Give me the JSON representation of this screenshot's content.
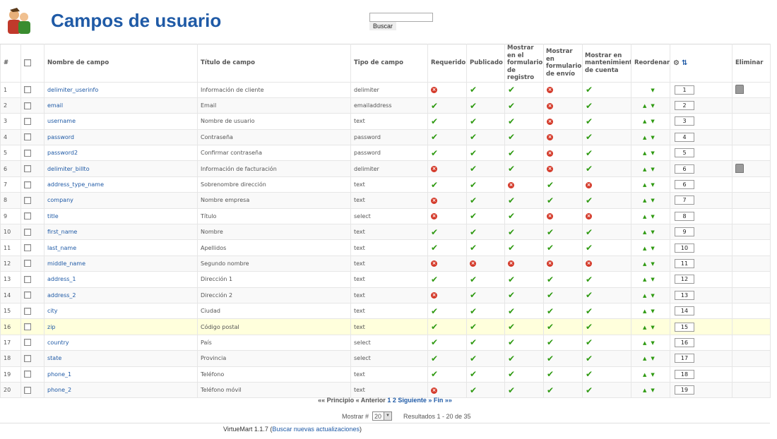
{
  "header": {
    "title": "Campos de usuario",
    "search_value": "",
    "search_button": "Buscar"
  },
  "columns": {
    "num": "#",
    "field_name": "Nombre de campo",
    "field_title": "Título de campo",
    "field_type": "Tipo de campo",
    "required": "Requerido",
    "published": "Publicado",
    "show_registration": "Mostrar en el formulario de registro",
    "show_shipping": "Mostrar en formulario de envío",
    "show_account": "Mostrar en mantenimiento de cuenta",
    "reorder": "Reordenar",
    "delete": "Eliminar"
  },
  "rows": [
    {
      "num": "1",
      "name": "delimiter_userinfo",
      "title": "Información de cliente",
      "type": "delimiter",
      "req": false,
      "pub": true,
      "reg": true,
      "ship": false,
      "acc": true,
      "order": "1",
      "up": false,
      "down": true,
      "del": true
    },
    {
      "num": "2",
      "name": "email",
      "title": "Email",
      "type": "emailaddress",
      "req": true,
      "pub": true,
      "reg": true,
      "ship": false,
      "acc": true,
      "order": "2",
      "up": true,
      "down": true,
      "del": false
    },
    {
      "num": "3",
      "name": "username",
      "title": "Nombre de usuario",
      "type": "text",
      "req": true,
      "pub": true,
      "reg": true,
      "ship": false,
      "acc": true,
      "order": "3",
      "up": true,
      "down": true,
      "del": false
    },
    {
      "num": "4",
      "name": "password",
      "title": "Contraseña",
      "type": "password",
      "req": true,
      "pub": true,
      "reg": true,
      "ship": false,
      "acc": true,
      "order": "4",
      "up": true,
      "down": true,
      "del": false
    },
    {
      "num": "5",
      "name": "password2",
      "title": "Confirmar contraseña",
      "type": "password",
      "req": true,
      "pub": true,
      "reg": true,
      "ship": false,
      "acc": true,
      "order": "5",
      "up": true,
      "down": true,
      "del": false
    },
    {
      "num": "6",
      "name": "delimiter_billto",
      "title": "Información de facturación",
      "type": "delimiter",
      "req": false,
      "pub": true,
      "reg": true,
      "ship": false,
      "acc": true,
      "order": "6",
      "up": true,
      "down": true,
      "del": true
    },
    {
      "num": "7",
      "name": "address_type_name",
      "title": "Sobrenombre dirección",
      "type": "text",
      "req": true,
      "pub": true,
      "reg": false,
      "ship": true,
      "acc": false,
      "order": "6",
      "up": true,
      "down": true,
      "del": false
    },
    {
      "num": "8",
      "name": "company",
      "title": "Nombre empresa",
      "type": "text",
      "req": false,
      "pub": true,
      "reg": true,
      "ship": true,
      "acc": true,
      "order": "7",
      "up": true,
      "down": true,
      "del": false
    },
    {
      "num": "9",
      "name": "title",
      "title": "Título",
      "type": "select",
      "req": false,
      "pub": true,
      "reg": true,
      "ship": false,
      "acc": false,
      "order": "8",
      "up": true,
      "down": true,
      "del": false
    },
    {
      "num": "10",
      "name": "first_name",
      "title": "Nombre",
      "type": "text",
      "req": true,
      "pub": true,
      "reg": true,
      "ship": true,
      "acc": true,
      "order": "9",
      "up": true,
      "down": true,
      "del": false
    },
    {
      "num": "11",
      "name": "last_name",
      "title": "Apellidos",
      "type": "text",
      "req": true,
      "pub": true,
      "reg": true,
      "ship": true,
      "acc": true,
      "order": "10",
      "up": true,
      "down": true,
      "del": false
    },
    {
      "num": "12",
      "name": "middle_name",
      "title": "Segundo nombre",
      "type": "text",
      "req": false,
      "pub": false,
      "reg": false,
      "ship": false,
      "acc": false,
      "order": "11",
      "up": true,
      "down": true,
      "del": false
    },
    {
      "num": "13",
      "name": "address_1",
      "title": "Dirección 1",
      "type": "text",
      "req": true,
      "pub": true,
      "reg": true,
      "ship": true,
      "acc": true,
      "order": "12",
      "up": true,
      "down": true,
      "del": false
    },
    {
      "num": "14",
      "name": "address_2",
      "title": "Dirección 2",
      "type": "text",
      "req": false,
      "pub": true,
      "reg": true,
      "ship": true,
      "acc": true,
      "order": "13",
      "up": true,
      "down": true,
      "del": false
    },
    {
      "num": "15",
      "name": "city",
      "title": "Ciudad",
      "type": "text",
      "req": true,
      "pub": true,
      "reg": true,
      "ship": true,
      "acc": true,
      "order": "14",
      "up": true,
      "down": true,
      "del": false
    },
    {
      "num": "16",
      "name": "zip",
      "title": "Código postal",
      "type": "text",
      "req": true,
      "pub": true,
      "reg": true,
      "ship": true,
      "acc": true,
      "order": "15",
      "up": true,
      "down": true,
      "del": false
    },
    {
      "num": "17",
      "name": "country",
      "title": "País",
      "type": "select",
      "req": true,
      "pub": true,
      "reg": true,
      "ship": true,
      "acc": true,
      "order": "16",
      "up": true,
      "down": true,
      "del": false
    },
    {
      "num": "18",
      "name": "state",
      "title": "Provincia",
      "type": "select",
      "req": true,
      "pub": true,
      "reg": true,
      "ship": true,
      "acc": true,
      "order": "17",
      "up": true,
      "down": true,
      "del": false
    },
    {
      "num": "19",
      "name": "phone_1",
      "title": "Teléfono",
      "type": "text",
      "req": true,
      "pub": true,
      "reg": true,
      "ship": true,
      "acc": true,
      "order": "18",
      "up": true,
      "down": true,
      "del": false
    },
    {
      "num": "20",
      "name": "phone_2",
      "title": "Teléfono móvil",
      "type": "text",
      "req": false,
      "pub": true,
      "reg": true,
      "ship": true,
      "acc": true,
      "order": "19",
      "up": true,
      "down": true,
      "del": false
    }
  ],
  "highlight_row": 16,
  "pagination": {
    "first": "«« Principio",
    "prev": "« Anterior",
    "page1": "1",
    "page2": "2",
    "next": "Siguiente »",
    "last": "Fin »»"
  },
  "limit": {
    "label": "Mostrar #",
    "value": "20",
    "results": "Resultados 1 - 20 de 35"
  },
  "footer": {
    "version": "VirtueMart 1.1.7",
    "link": "Buscar nuevas actualizaciones"
  },
  "colors": {
    "accent": "#1f5aa6",
    "check": "#2f9a12",
    "cross": "#d43a2a",
    "highlight": "#ffffdc"
  },
  "icons": {
    "check": "checkmark-icon",
    "cross": "red-x-icon",
    "up": "arrow-up-icon",
    "down": "arrow-down-icon",
    "trash": "trash-icon",
    "save_order": "save-order-icon",
    "sort": "sort-az-icon",
    "logo": "users-logo-icon"
  }
}
